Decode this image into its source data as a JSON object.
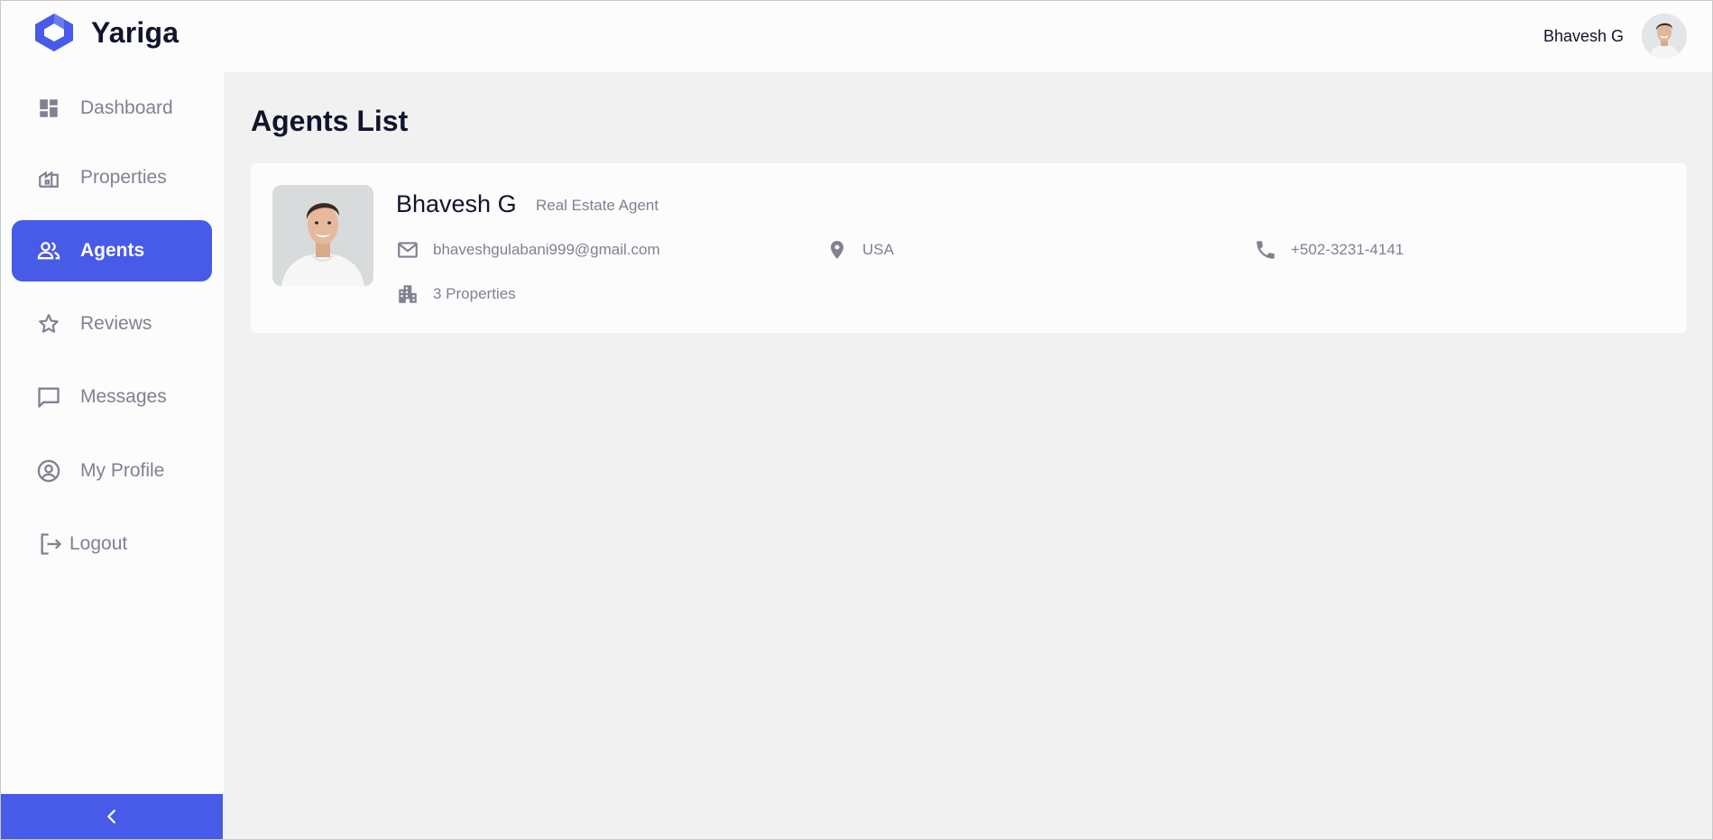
{
  "brand": {
    "name": "Yariga"
  },
  "header": {
    "user_name": "Bhavesh G"
  },
  "sidebar": {
    "items": [
      {
        "label": "Dashboard",
        "icon": "dashboard-icon",
        "active": false
      },
      {
        "label": "Properties",
        "icon": "properties-icon",
        "active": false
      },
      {
        "label": "Agents",
        "icon": "agents-icon",
        "active": true
      },
      {
        "label": "Reviews",
        "icon": "star-icon",
        "active": false
      },
      {
        "label": "Messages",
        "icon": "chat-icon",
        "active": false
      },
      {
        "label": "My Profile",
        "icon": "profile-icon",
        "active": false
      },
      {
        "label": "Logout",
        "icon": "logout-icon",
        "active": false
      }
    ],
    "collapse_icon": "chevron-left-icon"
  },
  "main": {
    "title": "Agents List",
    "agents": [
      {
        "name": "Bhavesh G",
        "role": "Real Estate Agent",
        "email": "bhaveshgulabani999@gmail.com",
        "location": "USA",
        "phone": "+502-3231-4141",
        "properties": "3 Properties"
      }
    ]
  },
  "colors": {
    "accent": "#475be8",
    "text_primary": "#11142d",
    "text_secondary": "#808191",
    "background": "#f1f1f1",
    "surface": "#fcfcfc"
  }
}
